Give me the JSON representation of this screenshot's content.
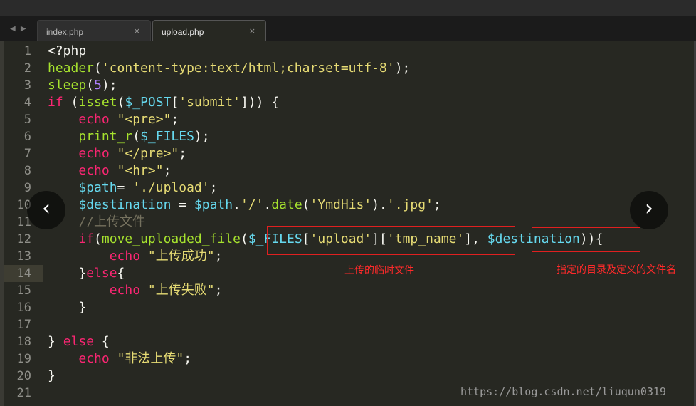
{
  "tabs": [
    {
      "label": "index.php",
      "close": "×",
      "active": false
    },
    {
      "label": "upload.php",
      "close": "×",
      "active": true
    }
  ],
  "nav_arrows": "◀ ▶",
  "editor": {
    "highlighted_line": 14,
    "lines": [
      {
        "n": "1",
        "code": "<?php"
      },
      {
        "n": "2",
        "code": "header('content-type:text/html;charset=utf-8');"
      },
      {
        "n": "3",
        "code": "sleep(5);"
      },
      {
        "n": "4",
        "code": "if (isset($_POST['submit'])) {"
      },
      {
        "n": "5",
        "code": "    echo \"<pre>\";"
      },
      {
        "n": "6",
        "code": "    print_r($_FILES);"
      },
      {
        "n": "7",
        "code": "    echo \"</pre>\";"
      },
      {
        "n": "8",
        "code": "    echo \"<hr>\";"
      },
      {
        "n": "9",
        "code": "    $path= './upload';"
      },
      {
        "n": "10",
        "code": "    $destination = $path.'/'.date('YmdHis').'.jpg';"
      },
      {
        "n": "11",
        "code": "    //上传文件"
      },
      {
        "n": "12",
        "code": "    if(move_uploaded_file($_FILES['upload']['tmp_name'], $destination)){"
      },
      {
        "n": "13",
        "code": "        echo \"上传成功\";"
      },
      {
        "n": "14",
        "code": "    }else{"
      },
      {
        "n": "15",
        "code": "        echo \"上传失败\";"
      },
      {
        "n": "16",
        "code": "    }"
      },
      {
        "n": "17",
        "code": ""
      },
      {
        "n": "18",
        "code": "} else {"
      },
      {
        "n": "19",
        "code": "    echo \"非法上传\";"
      },
      {
        "n": "20",
        "code": "}"
      },
      {
        "n": "21",
        "code": ""
      }
    ]
  },
  "annotations": {
    "temp_file": "上传的临时文件",
    "destination": "指定的目录及定义的文件名"
  },
  "nav_prev": "‹",
  "nav_next": "›",
  "watermark": "https://blog.csdn.net/liuqun0319",
  "colors": {
    "background": "#272822",
    "keyword": "#f92672",
    "function": "#a6e22e",
    "string": "#e6db74",
    "variable": "#66d9ef",
    "number": "#ae81ff",
    "comment": "#75715e",
    "annotation": "#ff2a2a"
  }
}
